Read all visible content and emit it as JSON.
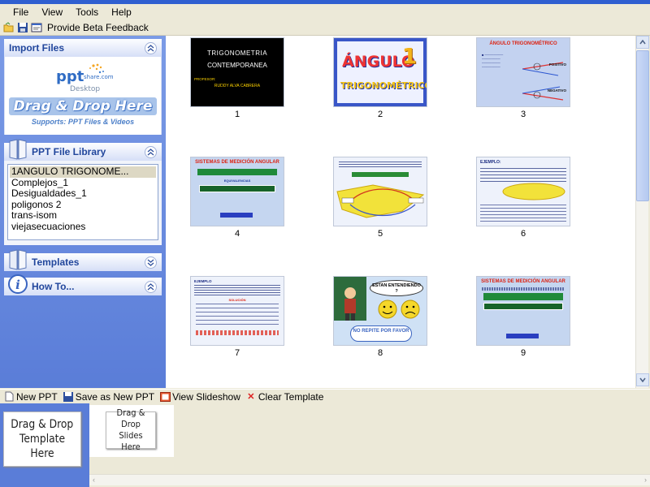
{
  "menu": [
    "File",
    "View",
    "Tools",
    "Help"
  ],
  "toolbar": {
    "beta_feedback": "Provide Beta Feedback"
  },
  "sidebar": {
    "import": {
      "title": "Import Files",
      "logo_text": "ppt",
      "logo_sub": "share.com",
      "logo_desktop": "Desktop",
      "drag_drop": "Drag & Drop Here",
      "supports": "Supports: PPT Files & Videos"
    },
    "library": {
      "title": "PPT File Library",
      "items": [
        "1ANGULO TRIGONOME...",
        "Complejos_1",
        "Desigualdades_1",
        "poligonos 2",
        "trans-isom",
        "viejasecuaciones"
      ]
    },
    "templates": {
      "title": "Templates"
    },
    "howto": {
      "title": "How To..."
    }
  },
  "slides": [
    {
      "num": "1",
      "title": "TRIGONOMETRIA",
      "subtitle": "CONTEMPORANEA",
      "presenter_label": "PROFESOR:",
      "presenter": "RUDDY ALVA CABRERA"
    },
    {
      "num": "2",
      "title": "ÁNGULO",
      "subtitle": "TRIGONOMÉTRICO",
      "badge": "1"
    },
    {
      "num": "3",
      "title": "ÁNGULO TRIGONOMÉTRICO",
      "pos": "POSITIVO",
      "neg": "NEGATIVO"
    },
    {
      "num": "4",
      "title": "SISTEMAS DE MEDICIÓN ANGULAR",
      "sub": "EQUIVALENCIAS"
    },
    {
      "num": "5"
    },
    {
      "num": "6",
      "title": "EJEMPLO:"
    },
    {
      "num": "7",
      "title": "EJEMPLO",
      "sub": "SOLUCIÓN"
    },
    {
      "num": "8",
      "bubble": "ESTAN ENTENDIENDO ?",
      "banner": "NO REPITE POR FAVOR"
    },
    {
      "num": "9",
      "title": "SISTEMAS DE MEDICIÓN ANGULAR"
    }
  ],
  "bottom_toolbar": {
    "new_ppt": "New PPT",
    "save_as": "Save as New PPT",
    "view_slideshow": "View Slideshow",
    "clear_template": "Clear Template"
  },
  "bottom": {
    "template_drop_line1": "Drag & Drop",
    "template_drop_line2": "Template Here",
    "slides_drop_line1": "Drag & Drop",
    "slides_drop_line2": "Slides Here"
  }
}
